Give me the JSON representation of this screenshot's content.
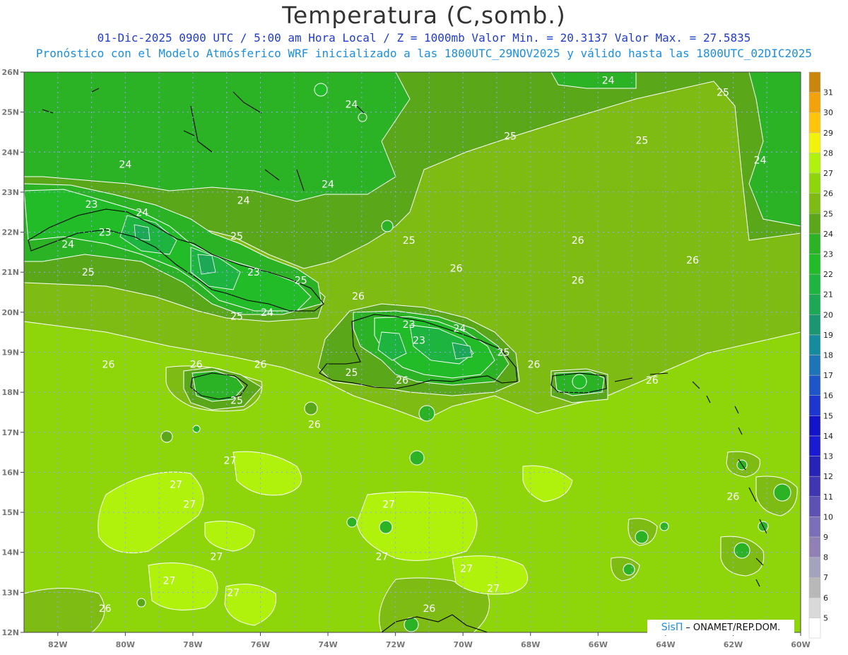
{
  "title": "Temperatura (C,somb.)",
  "subtitle_1": "01-Dic-2025  0900 UTC / 5:00 am Hora Local / Z = 1000mb   Valor Min. = 20.3137  Valor Max. = 27.5835",
  "subtitle_2": "Pronóstico con el Modelo Atmósferico WRF inicializado a las 1800UTC_29NOV2025 y válido hasta las  1800UTC_02DIC2025",
  "credit": {
    "brand": "SisΠ",
    "separator": "–",
    "org": "ONAMET/REP.DOM."
  },
  "chart_data": {
    "type": "heatmap",
    "variable": "Temperatura (C)",
    "level": "1000mb",
    "valid": "01-Dic-2025 0900 UTC",
    "min_value": 20.3137,
    "max_value": 27.5835,
    "lon_range": [
      -83.0,
      -60.0
    ],
    "lat_range": [
      12.0,
      26.0
    ],
    "x_ticks": [
      "82W",
      "80W",
      "78W",
      "76W",
      "74W",
      "72W",
      "70W",
      "68W",
      "66W",
      "64W",
      "62W",
      "60W"
    ],
    "y_ticks": [
      "12N",
      "13N",
      "14N",
      "15N",
      "16N",
      "17N",
      "18N",
      "19N",
      "20N",
      "21N",
      "22N",
      "23N",
      "24N",
      "25N",
      "26N"
    ],
    "colorbar": {
      "levels": [
        5,
        6,
        7,
        8,
        9,
        10,
        11,
        12,
        13,
        14,
        15,
        16,
        17,
        18,
        19,
        20,
        21,
        22,
        23,
        24,
        25,
        26,
        27,
        28,
        29,
        30,
        31
      ],
      "colors": [
        "#ffffff",
        "#d9d9d9",
        "#b8b8b8",
        "#a3a3bd",
        "#9080b4",
        "#7a6fb8",
        "#5d52b4",
        "#3f37b2",
        "#2624b6",
        "#1a1ad0",
        "#1313c8",
        "#1d36d0",
        "#1e55c8",
        "#1d74b6",
        "#178b9e",
        "#1a9770",
        "#1da855",
        "#1eb440",
        "#22bc28",
        "#2cb325",
        "#5aa81a",
        "#7ebc14",
        "#8ed60a",
        "#b0f20b",
        "#f2f20a",
        "#ffc40b",
        "#f2a20a",
        "#c9860d"
      ]
    },
    "contour_labels": [
      {
        "value": 24,
        "lon": -73.3,
        "lat": 25.2
      },
      {
        "value": 24,
        "lon": -65.7,
        "lat": 25.8
      },
      {
        "value": 25,
        "lon": -62.3,
        "lat": 25.5
      },
      {
        "value": 25,
        "lon": -68.6,
        "lat": 24.4
      },
      {
        "value": 25,
        "lon": -64.7,
        "lat": 24.3
      },
      {
        "value": 24,
        "lon": -61.2,
        "lat": 23.8
      },
      {
        "value": 24,
        "lon": -80.0,
        "lat": 23.7
      },
      {
        "value": 24,
        "lon": -74.0,
        "lat": 23.2
      },
      {
        "value": 23,
        "lon": -81.0,
        "lat": 22.7
      },
      {
        "value": 24,
        "lon": -79.5,
        "lat": 22.5
      },
      {
        "value": 24,
        "lon": -76.5,
        "lat": 22.8
      },
      {
        "value": 23,
        "lon": -80.6,
        "lat": 22.0
      },
      {
        "value": 25,
        "lon": -76.7,
        "lat": 21.9
      },
      {
        "value": 25,
        "lon": -71.6,
        "lat": 21.8
      },
      {
        "value": 26,
        "lon": -66.6,
        "lat": 21.8
      },
      {
        "value": 24,
        "lon": -81.7,
        "lat": 21.7
      },
      {
        "value": 25,
        "lon": -81.1,
        "lat": 21.0
      },
      {
        "value": 23,
        "lon": -76.2,
        "lat": 21.0
      },
      {
        "value": 26,
        "lon": -70.2,
        "lat": 21.1
      },
      {
        "value": 26,
        "lon": -63.2,
        "lat": 21.3
      },
      {
        "value": 25,
        "lon": -74.8,
        "lat": 20.8
      },
      {
        "value": 26,
        "lon": -66.6,
        "lat": 20.8
      },
      {
        "value": 26,
        "lon": -73.1,
        "lat": 20.4
      },
      {
        "value": 25,
        "lon": -76.7,
        "lat": 19.9
      },
      {
        "value": 24,
        "lon": -75.8,
        "lat": 20.0
      },
      {
        "value": 23,
        "lon": -71.6,
        "lat": 19.7
      },
      {
        "value": 24,
        "lon": -70.1,
        "lat": 19.6
      },
      {
        "value": 23,
        "lon": -71.3,
        "lat": 19.3
      },
      {
        "value": 25,
        "lon": -68.8,
        "lat": 19.0
      },
      {
        "value": 26,
        "lon": -80.5,
        "lat": 18.7
      },
      {
        "value": 26,
        "lon": -77.9,
        "lat": 18.7
      },
      {
        "value": 26,
        "lon": -76.0,
        "lat": 18.7
      },
      {
        "value": 26,
        "lon": -67.9,
        "lat": 18.7
      },
      {
        "value": 25,
        "lon": -73.3,
        "lat": 18.5
      },
      {
        "value": 26,
        "lon": -71.8,
        "lat": 18.3
      },
      {
        "value": 26,
        "lon": -64.4,
        "lat": 18.3
      },
      {
        "value": 25,
        "lon": -76.7,
        "lat": 17.8
      },
      {
        "value": 26,
        "lon": -74.4,
        "lat": 17.2
      },
      {
        "value": 27,
        "lon": -76.9,
        "lat": 16.3
      },
      {
        "value": 27,
        "lon": -78.5,
        "lat": 15.7
      },
      {
        "value": 27,
        "lon": -78.1,
        "lat": 15.2
      },
      {
        "value": 27,
        "lon": -72.2,
        "lat": 15.2
      },
      {
        "value": 26,
        "lon": -62.0,
        "lat": 15.4
      },
      {
        "value": 27,
        "lon": -77.3,
        "lat": 13.9
      },
      {
        "value": 27,
        "lon": -72.4,
        "lat": 13.9
      },
      {
        "value": 27,
        "lon": -78.7,
        "lat": 13.3
      },
      {
        "value": 27,
        "lon": -69.9,
        "lat": 13.6
      },
      {
        "value": 27,
        "lon": -69.1,
        "lat": 13.1
      },
      {
        "value": 27,
        "lon": -76.8,
        "lat": 13.0
      },
      {
        "value": 26,
        "lon": -80.6,
        "lat": 12.6
      },
      {
        "value": 26,
        "lon": -71.0,
        "lat": 12.6
      }
    ]
  }
}
